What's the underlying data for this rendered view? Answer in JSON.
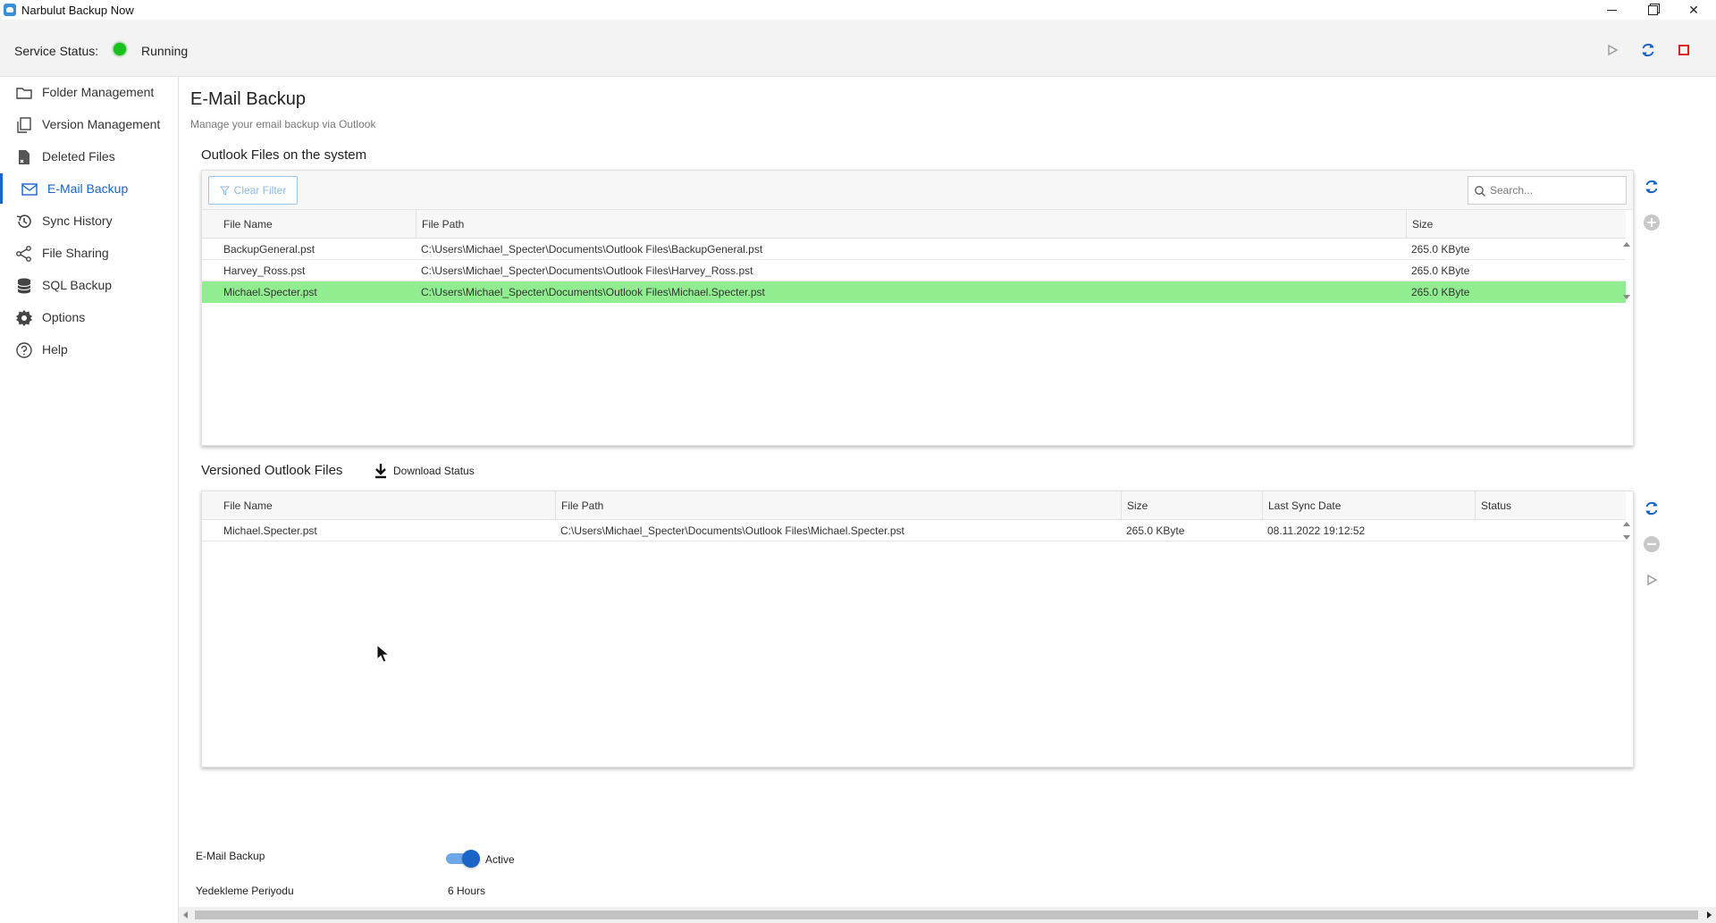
{
  "window": {
    "title": "Narbulut Backup Now",
    "app_icon": "cloud-app-icon",
    "controls": [
      "minimize-icon",
      "restore-icon",
      "close-icon"
    ],
    "close_glyph": "✕"
  },
  "service": {
    "label": "Service Status:",
    "status": "Running",
    "status_color": "#18c21e",
    "actions": [
      "play-icon",
      "refresh-icon",
      "stop-icon"
    ],
    "accent_blue": "#1a64c8",
    "stop_color": "#e02020"
  },
  "sidebar": {
    "items": [
      {
        "label": "Folder Management",
        "icon": "folder-icon"
      },
      {
        "label": "Version Management",
        "icon": "versions-icon"
      },
      {
        "label": "Deleted Files",
        "icon": "deleted-file-icon"
      },
      {
        "label": "E-Mail Backup",
        "icon": "mail-icon",
        "active": true
      },
      {
        "label": "Sync History",
        "icon": "history-icon"
      },
      {
        "label": "File Sharing",
        "icon": "share-icon"
      },
      {
        "label": "SQL Backup",
        "icon": "database-icon"
      },
      {
        "label": "Options",
        "icon": "gear-icon"
      },
      {
        "label": "Help",
        "icon": "help-icon"
      }
    ]
  },
  "page": {
    "title": "E-Mail Backup",
    "subtitle": "Manage your email backup via Outlook"
  },
  "outlook_files": {
    "title": "Outlook Files on the system",
    "clear_filter": "Clear Filter",
    "search_placeholder": "Search...",
    "columns": [
      "File Name",
      "File Path",
      "Size"
    ],
    "rows": [
      {
        "name": "BackupGeneral.pst",
        "path": "C:\\Users\\Michael_Specter\\Documents\\Outlook Files\\BackupGeneral.pst",
        "size": "265.0 KByte",
        "selected": false
      },
      {
        "name": "Harvey_Ross.pst",
        "path": "C:\\Users\\Michael_Specter\\Documents\\Outlook Files\\Harvey_Ross.pst",
        "size": "265.0 KByte",
        "selected": false
      },
      {
        "name": "Michael.Specter.pst",
        "path": "C:\\Users\\Michael_Specter\\Documents\\Outlook Files\\Michael.Specter.pst",
        "size": "265.0 KByte",
        "selected": true
      }
    ],
    "selected_color": "#90ee90",
    "side_actions": [
      "refresh-icon",
      "add-circle-icon"
    ]
  },
  "versioned_files": {
    "title": "Versioned Outlook Files",
    "download_status": "Download Status",
    "columns": [
      "File Name",
      "File Path",
      "Size",
      "Last Sync Date",
      "Status"
    ],
    "rows": [
      {
        "name": "Michael.Specter.pst",
        "path": "C:\\Users\\Michael_Specter\\Documents\\Outlook Files\\Michael.Specter.pst",
        "size": "265.0 KByte",
        "last_sync": "08.11.2022 19:12:52",
        "status": ""
      }
    ],
    "side_actions": [
      "refresh-icon",
      "remove-circle-icon",
      "play-icon"
    ]
  },
  "settings": {
    "email_backup_label": "E-Mail Backup",
    "email_backup_state": "Active",
    "email_backup_on": true,
    "period_label": "Yedekleme Periyodu",
    "period_value": "6 Hours"
  }
}
